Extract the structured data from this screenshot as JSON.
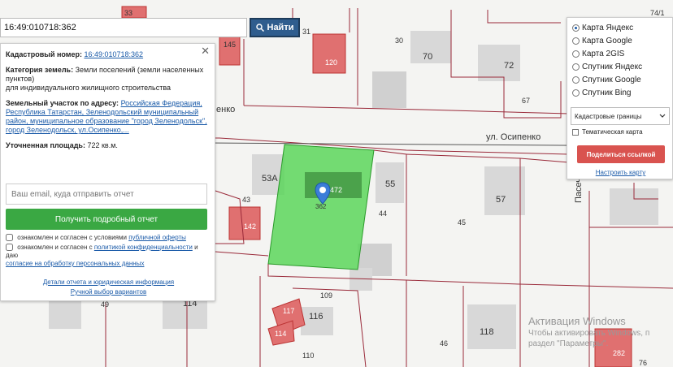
{
  "search": {
    "value": "16:49:010718:362",
    "button_label": "Найти"
  },
  "info": {
    "cadastral_label": "Кадастровый номер:",
    "cadastral_value": "16:49:010718:362",
    "category_label": "Категория земель:",
    "category_value": "Земли поселений (земли населенных пунктов)",
    "category_use": "для индивидуального жилищного строительства",
    "address_label": "Земельный участок по адресу:",
    "address_value": "Российская Федерация, Республика Татарстан, Зеленодольский муниципальный район, муниципальное образование \"город Зеленодольск\", город Зеленодольск, ул.Осипенко,...",
    "area_label": "Уточненная площадь:",
    "area_value": "722 кв.м.",
    "email_placeholder": "Ваш email, куда отправить отчет",
    "report_button": "Получить подробный отчет",
    "agree1_prefix": "ознакомлен и согласен с условиями",
    "agree1_link": "публичной оферты",
    "agree2_prefix": "ознакомлен и согласен с",
    "agree2_link1": "политикой конфиденциальности",
    "agree2_mid": "и даю",
    "agree2_link2": "согласие на обработку персональных данных",
    "details_link": "Детали отчета и юридическая информация",
    "manual_link": "Ручной выбор вариантов",
    "close": "✕"
  },
  "layers": {
    "options": [
      {
        "label": "Карта Яндекс",
        "selected": true
      },
      {
        "label": "Карта Google",
        "selected": false
      },
      {
        "label": "Карта 2GIS",
        "selected": false
      },
      {
        "label": "Спутник Яндекс",
        "selected": false
      },
      {
        "label": "Спутник Google",
        "selected": false
      },
      {
        "label": "Спутник Bing",
        "selected": false
      }
    ],
    "select_value": "Кадастровые границы",
    "thematic_label": "Тематическая карта",
    "share_button": "Поделиться ссылкой",
    "setup_link": "Настроить карту"
  },
  "map": {
    "street1": "ул. Осипенко",
    "street_partial": "енко",
    "street_vertical": "Пасечн",
    "labels": [
      "33",
      "31",
      "30",
      "70",
      "72",
      "74/1",
      "145",
      "120",
      "67",
      "53А",
      "55",
      "57",
      "43",
      "142",
      "472",
      "362",
      "44",
      "45",
      "109",
      "117",
      "116",
      "114",
      "49",
      "118",
      "46",
      "110",
      "114",
      "282",
      "76"
    ]
  },
  "watermark": {
    "title": "Активация Windows",
    "line2": "Чтобы активировать Windows, п",
    "line3": "раздел \"Параметры\"."
  }
}
